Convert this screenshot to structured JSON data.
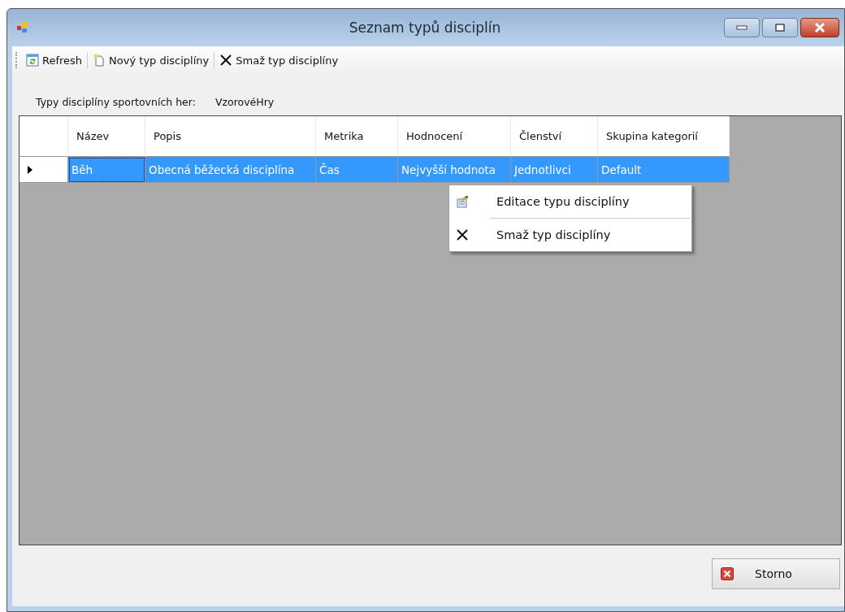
{
  "window": {
    "title": "Seznam typů disciplín"
  },
  "toolbar": [
    {
      "kind": "refresh",
      "label": "Refresh"
    },
    {
      "kind": "new",
      "label": "Nový typ disciplíny"
    },
    {
      "kind": "delete",
      "label": "Smaž typ disciplíny"
    }
  ],
  "games": {
    "label": "Typy disciplíny sportovních her:",
    "value": "VzorovéHry"
  },
  "table": {
    "columns": [
      "Název",
      "Popis",
      "Metrika",
      "Hodnocení",
      "Členství",
      "Skupina kategorií"
    ],
    "rows": [
      {
        "selected": true,
        "current": true,
        "cells": [
          "Běh",
          "Obecná běžecká disciplína",
          "Čas",
          "Nejvyšší hodnota",
          "Jednotlivci",
          "Default"
        ]
      }
    ]
  },
  "context_menu": [
    {
      "kind": "edit",
      "label": "Editace typu disciplíny"
    },
    {
      "kind": "delete",
      "label": "Smaž typ disciplíny"
    }
  ],
  "buttons": [
    {
      "kind": "cancel",
      "label": "Storno"
    }
  ]
}
